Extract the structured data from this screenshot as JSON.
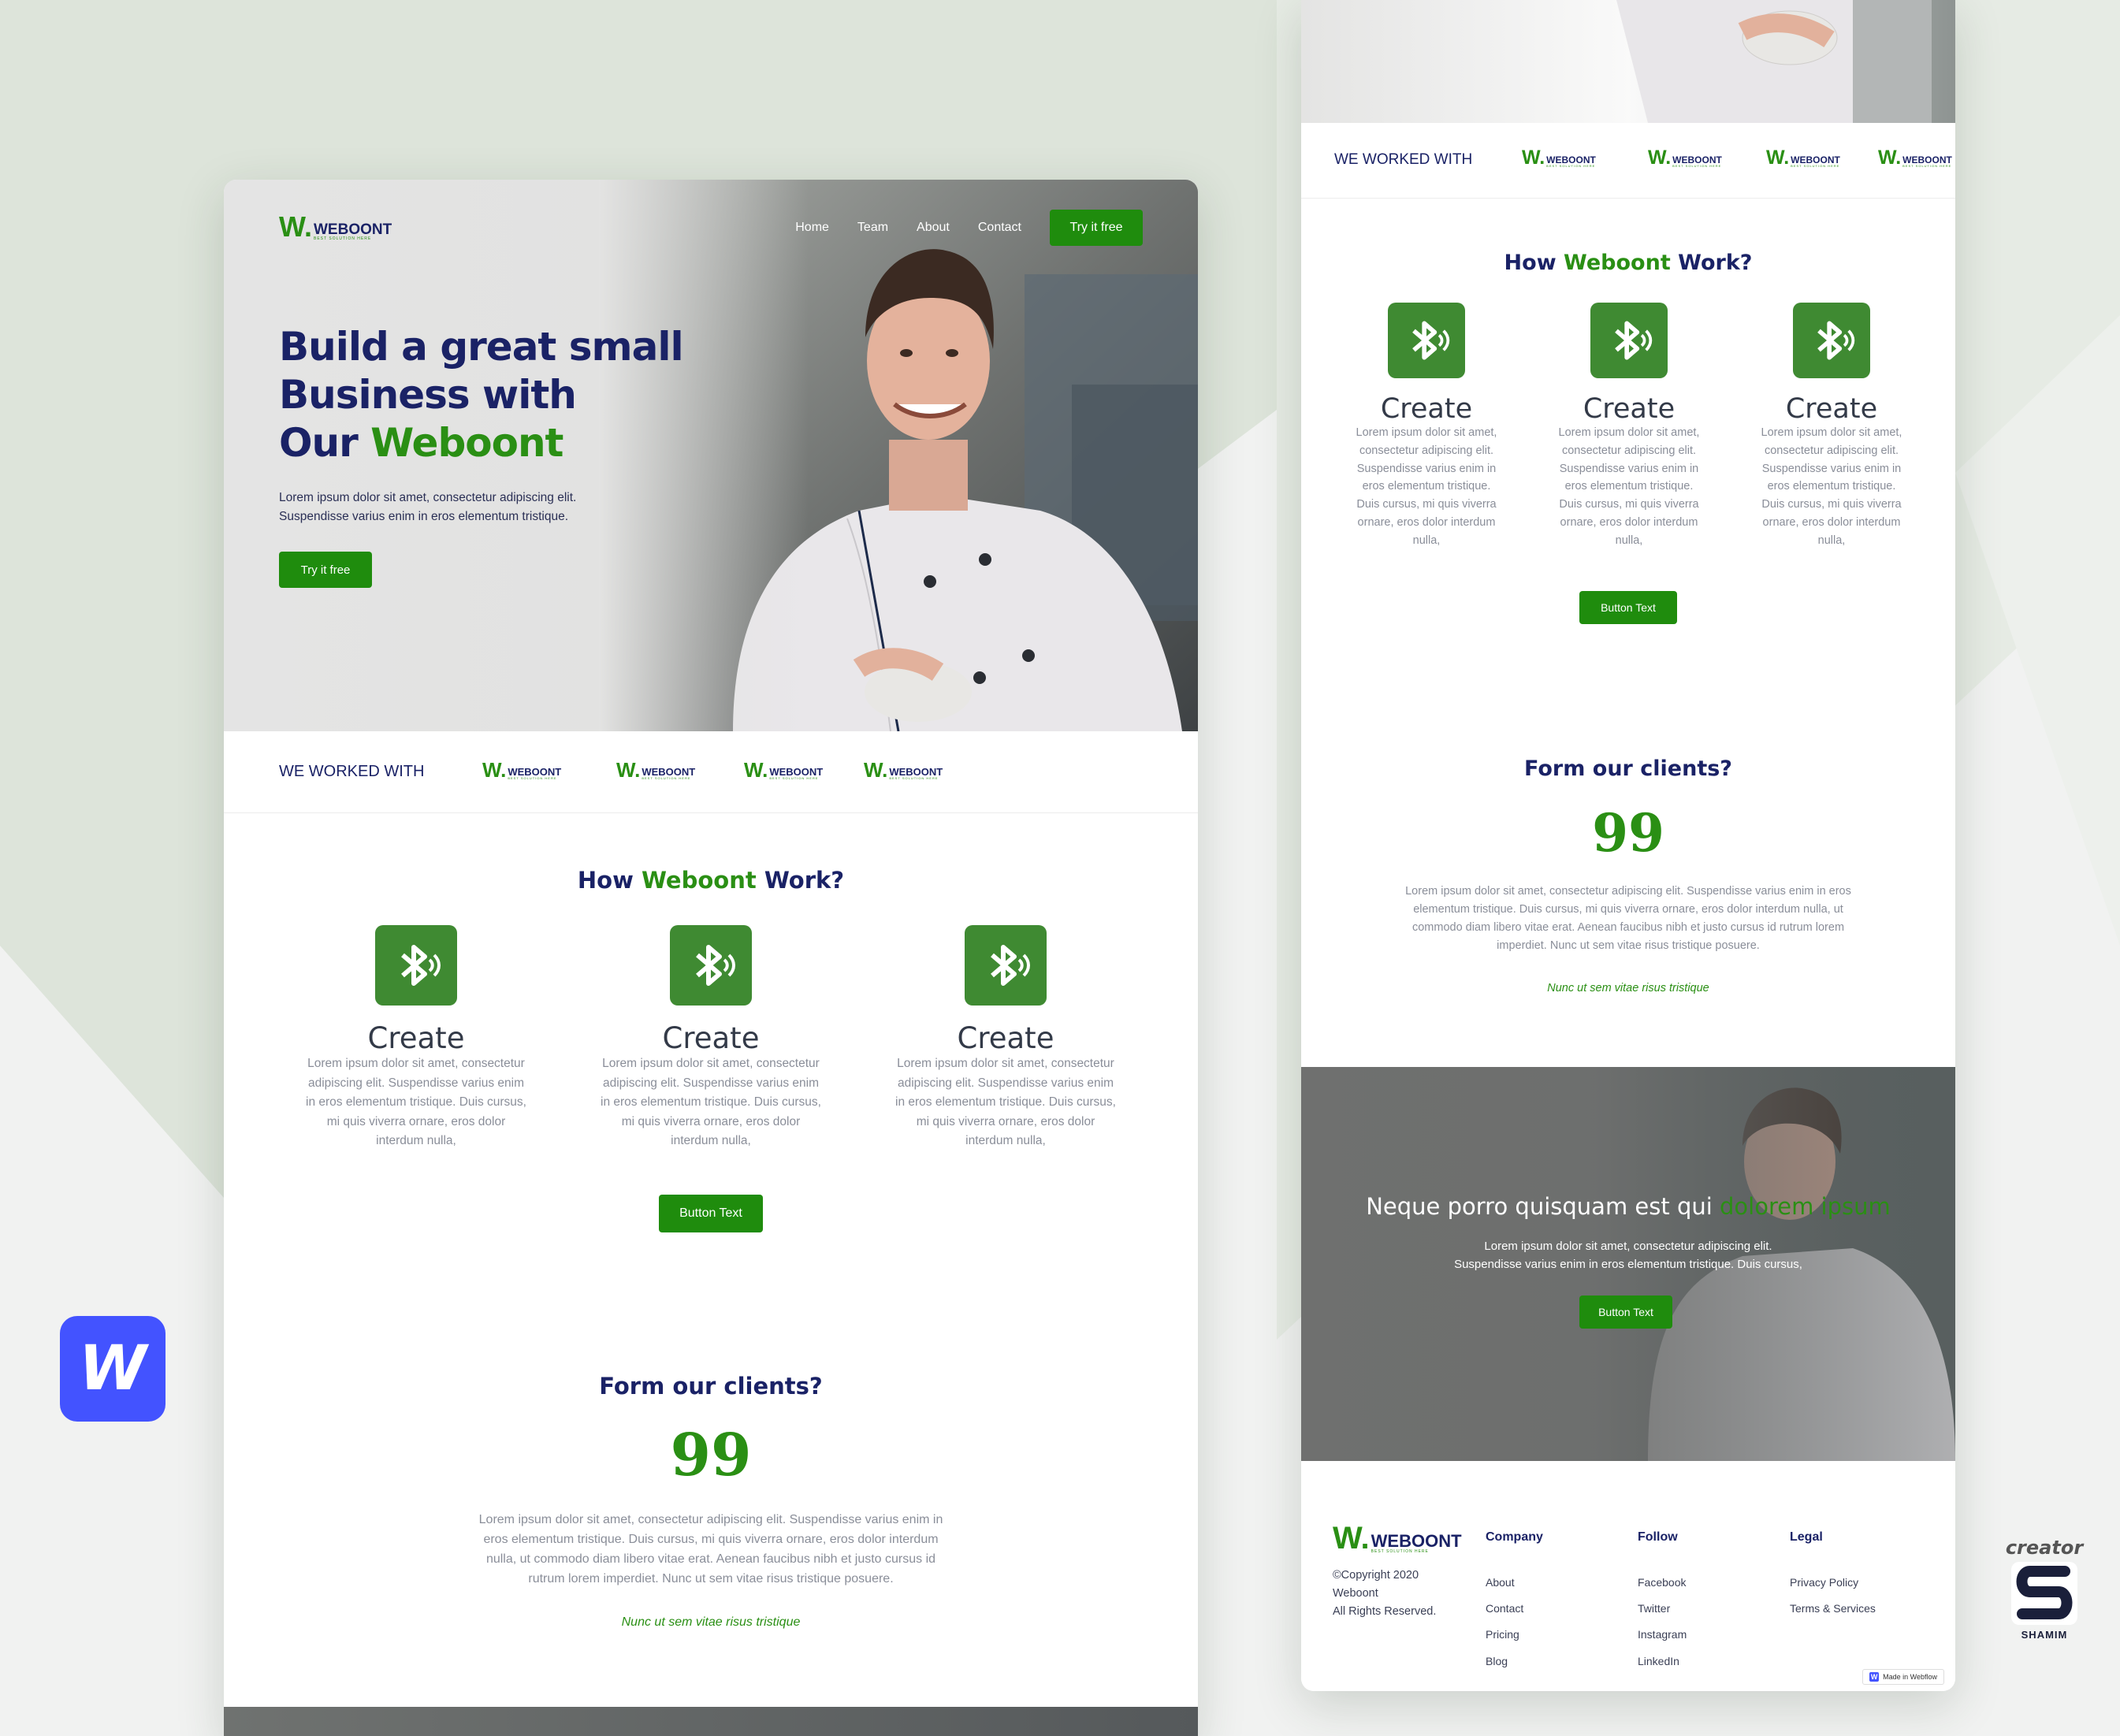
{
  "brand": {
    "logo_mark": "W.",
    "logo_name": "WEBOONT",
    "logo_tagline": "BEST SOLUTION HERE"
  },
  "colors": {
    "accent": "#1f8c0d",
    "navy": "#1a2266",
    "background": "#f1f2f1",
    "webflow_blue": "#4353ff"
  },
  "nav": {
    "items": [
      "Home",
      "Team",
      "About",
      "Contact"
    ],
    "cta": "Try it free"
  },
  "hero": {
    "title_line1": "Build a great small",
    "title_line2": "Business with",
    "title_line3_a": "Our ",
    "title_line3_b": "Weboont",
    "desc_line1": "Lorem ipsum dolor sit amet, consectetur adipiscing elit.",
    "desc_line2": "Suspendisse varius enim in eros elementum tristique.",
    "cta": "Try it free"
  },
  "worked": {
    "label": "WE WORKED WITH"
  },
  "how": {
    "title_a": "How ",
    "title_b": "Weboont",
    "title_c": " Work?",
    "button": "Button Text",
    "features": [
      {
        "icon": "bluetooth-icon",
        "title": "Create",
        "body": "Lorem ipsum dolor sit amet, consectetur adipiscing elit. Suspendisse varius enim in eros elementum tristique. Duis cursus, mi quis viverra ornare, eros dolor interdum nulla,"
      },
      {
        "icon": "bluetooth-icon",
        "title": "Create",
        "body": "Lorem ipsum dolor sit amet, consectetur adipiscing elit. Suspendisse varius enim in eros elementum tristique. Duis cursus, mi quis viverra ornare, eros dolor interdum nulla,"
      },
      {
        "icon": "bluetooth-icon",
        "title": "Create",
        "body": "Lorem ipsum dolor sit amet, consectetur adipiscing elit. Suspendisse varius enim in eros elementum tristique. Duis cursus, mi quis viverra ornare, eros dolor interdum nulla,"
      }
    ]
  },
  "clients": {
    "title": "Form our clients?",
    "quote_mark": "99",
    "quote": "Lorem ipsum dolor sit amet, consectetur adipiscing elit. Suspendisse varius enim in eros elementum tristique. Duis cursus, mi quis viverra ornare, eros dolor interdum nulla, ut commodo diam libero vitae erat. Aenean faucibus nibh et justo cursus id rutrum lorem imperdiet. Nunc ut sem vitae risus tristique posuere.",
    "author": "Nunc ut sem vitae risus tristique"
  },
  "cta_band": {
    "title_a": "Neque porro quisquam est qui ",
    "title_b": "dolorem ipsum",
    "desc_line1": "Lorem ipsum dolor sit amet, consectetur adipiscing elit.",
    "desc_line2": "Suspendisse varius enim in eros elementum tristique. Duis cursus,",
    "button": "Button Text"
  },
  "footer": {
    "copyright_line1": "©Copyright 2020",
    "copyright_line2": "Weboont",
    "copyright_line3": "All Rights Reserved.",
    "company": {
      "title": "Company",
      "links": [
        "About",
        "Contact",
        "Pricing",
        "Blog"
      ]
    },
    "follow": {
      "title": "Follow",
      "links": [
        "Facebook",
        "Twitter",
        "Instagram",
        "LinkedIn"
      ]
    },
    "legal": {
      "title": "Legal",
      "links": [
        "Privacy Policy",
        "Terms & Services"
      ]
    },
    "badge": "Made in Webflow"
  },
  "decor": {
    "webflow_letter": "W",
    "creator_label": "creator",
    "creator_name": "SHAMIM"
  }
}
